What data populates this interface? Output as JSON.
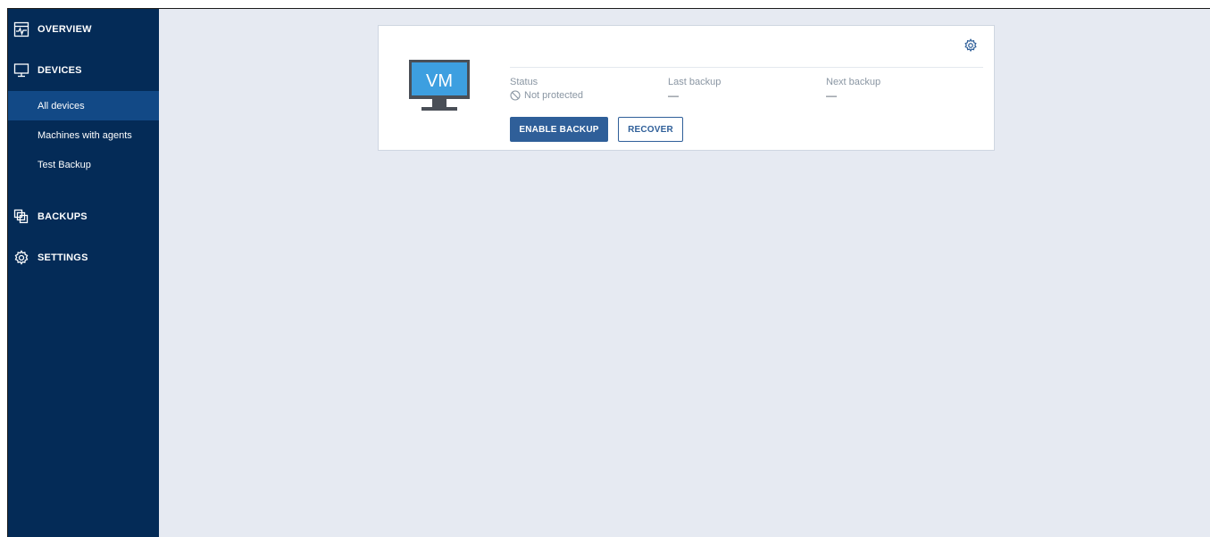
{
  "sidebar": {
    "overview": "OVERVIEW",
    "devices": "DEVICES",
    "device_items": [
      "All devices",
      "Machines with agents",
      "Test Backup"
    ],
    "backups": "BACKUPS",
    "settings": "SETTINGS"
  },
  "device_card": {
    "monitor_label": "VM",
    "status_label": "Status",
    "status_value": "Not protected",
    "last_backup_label": "Last backup",
    "last_backup_value": "—",
    "next_backup_label": "Next backup",
    "next_backup_value": "—",
    "enable_backup": "ENABLE BACKUP",
    "recover": "RECOVER"
  },
  "colors": {
    "sidebar_bg": "#042b57",
    "sidebar_active": "#124986",
    "main_bg": "#e6eaf2",
    "accent": "#2f5f99"
  }
}
